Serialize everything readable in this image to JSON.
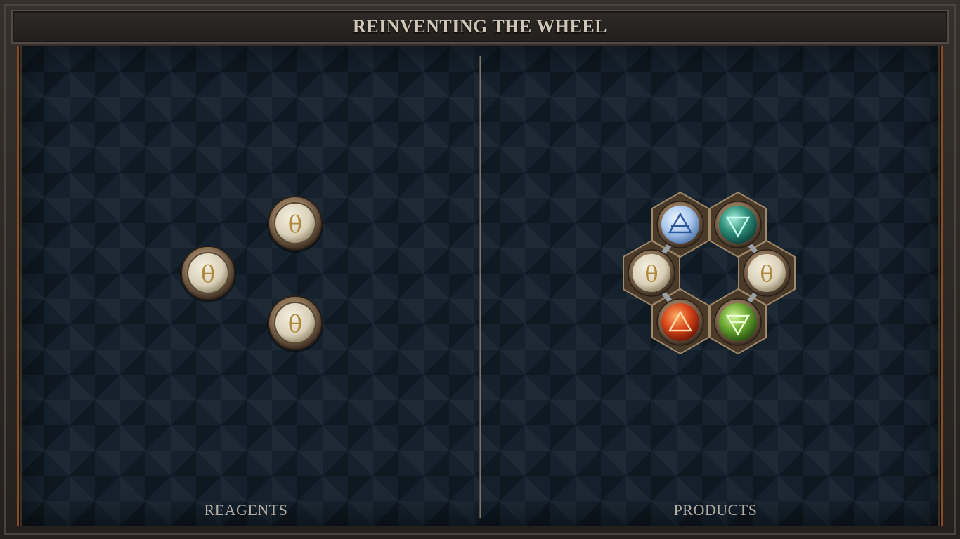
{
  "title": "REINVENTING THE WHEEL",
  "reagents_label": "REAGENTS",
  "products_label": "PRODUCTS",
  "symbols": {
    "salt": "θ",
    "air": "air-triangle",
    "water": "water-triangle",
    "fire": "fire-triangle",
    "earth": "earth-triangle"
  },
  "colors": {
    "salt": "#e6dfcc",
    "air": "#a9c8ec",
    "water": "#2f8f79",
    "fire": "#d8461a",
    "earth": "#6aa832",
    "bond": "#9aa0a6",
    "rim": "#8b7156",
    "divider": "#8a8078",
    "border_accent": "#8a4a22"
  },
  "reagents": [
    {
      "element": "salt",
      "icon": "salt-icon"
    },
    {
      "element": "salt",
      "icon": "salt-icon"
    },
    {
      "element": "salt",
      "icon": "salt-icon"
    }
  ],
  "product": {
    "atoms": [
      {
        "element": "air",
        "icon": "air-icon"
      },
      {
        "element": "water",
        "icon": "water-icon"
      },
      {
        "element": "salt",
        "icon": "salt-icon"
      },
      {
        "element": "salt",
        "icon": "salt-icon"
      },
      {
        "element": "fire",
        "icon": "fire-icon"
      },
      {
        "element": "earth",
        "icon": "earth-icon"
      }
    ],
    "bonds": [
      [
        0,
        2
      ],
      [
        1,
        3
      ],
      [
        2,
        4
      ],
      [
        3,
        5
      ]
    ]
  }
}
